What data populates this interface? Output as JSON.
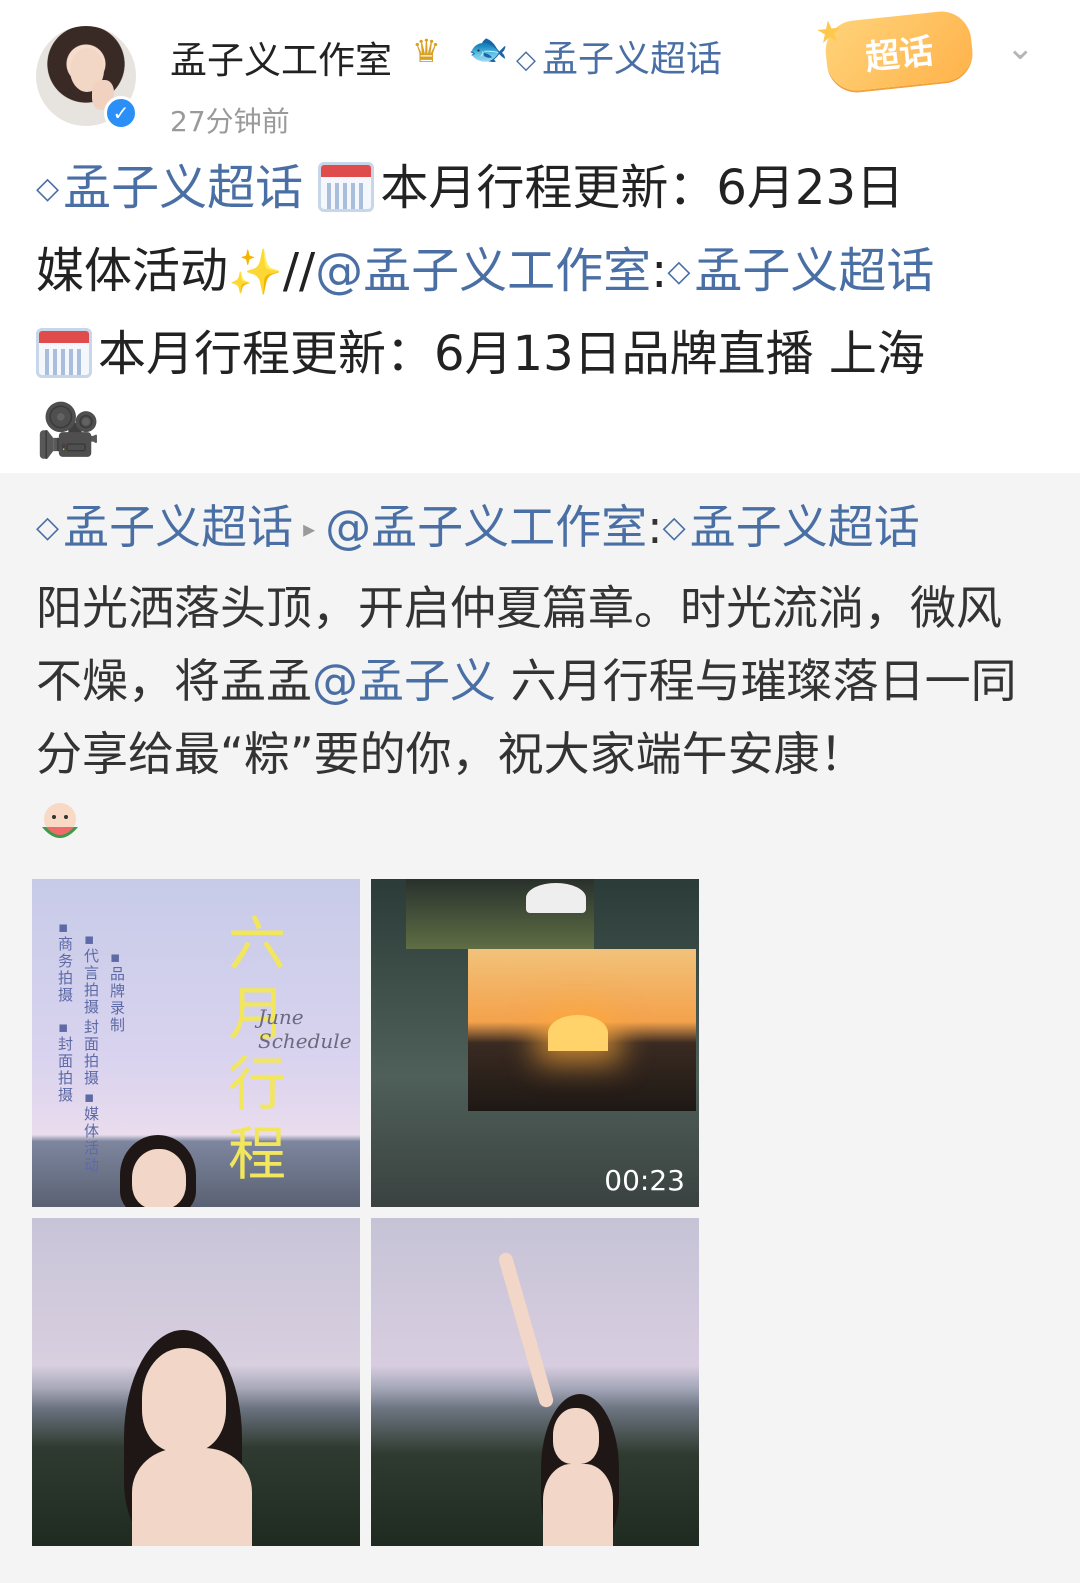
{
  "header": {
    "name": "孟子义工作室",
    "super_topic_link": "孟子义超话",
    "time": "27分钟前",
    "badge_label": "超话"
  },
  "post": {
    "line1_topic": "孟子义超话",
    "line1_text": "本月行程更新：6月23日",
    "line2_text": "媒体活动",
    "line2_sep": "//",
    "line2_mention": "@孟子义工作室",
    "line2_colon": ":",
    "line2_topic": "孟子义超话",
    "line3_text": "本月行程更新：6月13日品牌直播 上海"
  },
  "repost": {
    "topic": "孟子义超话",
    "mention": "@孟子义工作室",
    "colon": ":",
    "topic2": "孟子义超话",
    "text_part1": "阳光洒落头顶，开启仲夏篇章。时光流淌，微风不燥，将孟孟",
    "mention2": "@孟子义",
    "text_part2": " 六月行程与璀璨落日一同分享给最“粽”要的你，祝大家端午安康！",
    "video_duration": "00:23",
    "poster_title": "六月行程",
    "poster_subtitle": "June Schedule"
  },
  "colors": {
    "link": "#4a6fa5",
    "verified": "#2a8ff7",
    "repost_bg": "#f4f4f4"
  },
  "icons": [
    "crown-icon",
    "koi-fish-icon",
    "diamond-icon",
    "calendar-icon",
    "sparkles-icon",
    "movie-camera-icon",
    "chevron-down-icon",
    "verified-icon"
  ]
}
